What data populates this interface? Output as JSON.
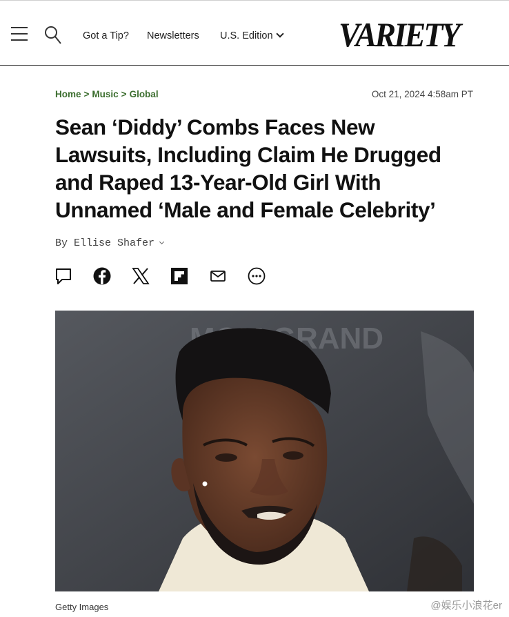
{
  "header": {
    "nav": {
      "tip_label": "Got a Tip?",
      "newsletters_label": "Newsletters",
      "edition_label": "U.S. Edition"
    },
    "logo_text": "VARIETY",
    "icons": [
      "menu-icon",
      "search-icon",
      "chevron-down-icon"
    ]
  },
  "article": {
    "breadcrumb": [
      "Home",
      "Music",
      "Global"
    ],
    "breadcrumb_separator": ">",
    "timestamp": "Oct 21, 2024 4:58am PT",
    "headline": "Sean ‘Diddy’ Combs Faces New Lawsuits, Including Claim He Drugged and Raped 13-Year-Old Girl With Unnamed ‘Male and Female Celebrity’",
    "byline_prefix": "By",
    "author": "Ellise Shafer",
    "share_icons": [
      "comment-icon",
      "facebook-icon",
      "x-icon",
      "flipboard-icon",
      "email-icon",
      "more-icon"
    ],
    "image_caption": "Getty Images",
    "image_backdrop_text": "MGM GRAND"
  },
  "watermark": "@娱乐小浪花er",
  "colors": {
    "breadcrumb": "#3c6e2f",
    "text": "#111111",
    "hero_background": "#3b3d42"
  }
}
